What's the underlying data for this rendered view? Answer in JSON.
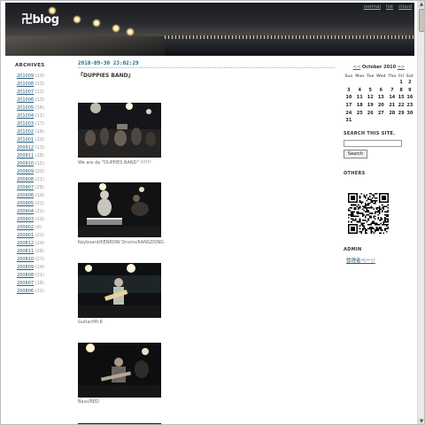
{
  "header": {
    "site_title": "卍blog",
    "links": [
      "normal",
      "list",
      "cloud"
    ]
  },
  "archives": {
    "heading": "ARCHIVES",
    "items": [
      {
        "label": "201009",
        "count": "(10)"
      },
      {
        "label": "201008",
        "count": "(13)"
      },
      {
        "label": "201007",
        "count": "(12)"
      },
      {
        "label": "201006",
        "count": "(13)"
      },
      {
        "label": "201005",
        "count": "(16)"
      },
      {
        "label": "201004",
        "count": "(11)"
      },
      {
        "label": "201003",
        "count": "(17)"
      },
      {
        "label": "201002",
        "count": "(16)"
      },
      {
        "label": "201001",
        "count": "(10)"
      },
      {
        "label": "200912",
        "count": "(13)"
      },
      {
        "label": "200911",
        "count": "(18)"
      },
      {
        "label": "200910",
        "count": "(15)"
      },
      {
        "label": "200909",
        "count": "(20)"
      },
      {
        "label": "200908",
        "count": "(21)"
      },
      {
        "label": "200907",
        "count": "(28)"
      },
      {
        "label": "200906",
        "count": "(19)"
      },
      {
        "label": "200905",
        "count": "(22)"
      },
      {
        "label": "200904",
        "count": "(21)"
      },
      {
        "label": "200903",
        "count": "(10)"
      },
      {
        "label": "200902",
        "count": "(9)"
      },
      {
        "label": "200901",
        "count": "(22)"
      },
      {
        "label": "200812",
        "count": "(24)"
      },
      {
        "label": "200811",
        "count": "(26)"
      },
      {
        "label": "200810",
        "count": "(27)"
      },
      {
        "label": "200809",
        "count": "(24)"
      },
      {
        "label": "200808",
        "count": "(31)"
      },
      {
        "label": "200807",
        "count": "(16)"
      },
      {
        "label": "200806",
        "count": "(12)"
      }
    ]
  },
  "post": {
    "date": "2010-09-30 23:02:29",
    "title": "『DUPPIES BAND』",
    "captions": [
      "We are da \"DUPPIES BAND\" !!!!!!",
      "Keyboard/KENROW  Drums/KANGDONG",
      "Guitar/Mr.K",
      "Bass/RED"
    ]
  },
  "calendar": {
    "prev": "<<",
    "month": "October 2010",
    "next": ">>",
    "weekdays": [
      "Sun",
      "Mon",
      "Tue",
      "Wed",
      "Thu",
      "Fri",
      "Sat"
    ],
    "weeks": [
      [
        "",
        "",
        "",
        "",
        "",
        "1",
        "2"
      ],
      [
        "3",
        "4",
        "5",
        "6",
        "7",
        "8",
        "9"
      ],
      [
        "10",
        "11",
        "12",
        "13",
        "14",
        "15",
        "16"
      ],
      [
        "17",
        "18",
        "19",
        "20",
        "21",
        "22",
        "23"
      ],
      [
        "24",
        "25",
        "26",
        "27",
        "28",
        "29",
        "30"
      ],
      [
        "31",
        "",
        "",
        "",
        "",
        "",
        ""
      ]
    ]
  },
  "search": {
    "heading": "SEARCH THIS SITE.",
    "value": "",
    "button": "Search"
  },
  "others": {
    "heading": "OTHERS"
  },
  "admin": {
    "heading": "ADMIN",
    "link": "管理者ページ"
  },
  "colors": {
    "link": "#2a5d7a",
    "date": "#2a6d8a",
    "header_bg": "#1a1c20"
  }
}
